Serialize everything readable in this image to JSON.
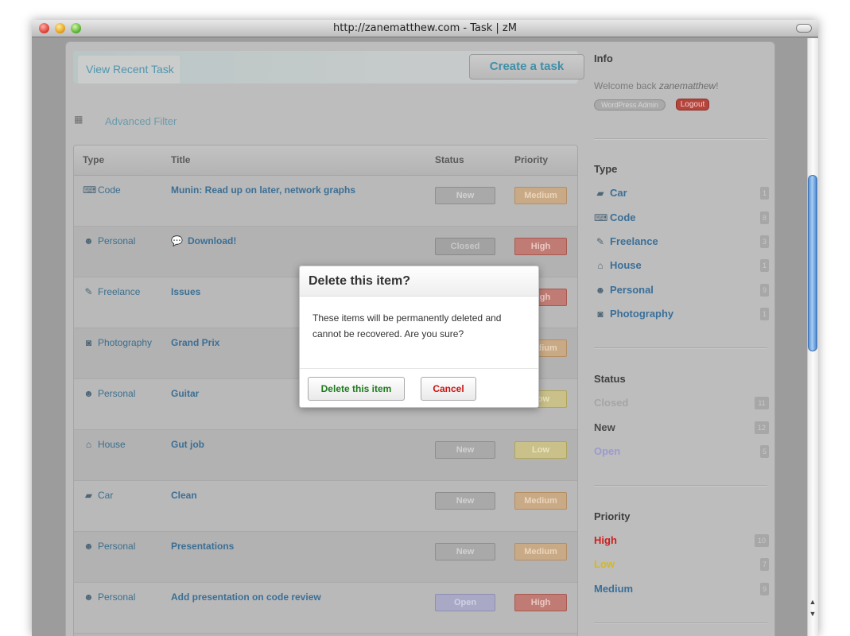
{
  "window": {
    "title": "http://zanematthew.com - Task | zM"
  },
  "header": {
    "tab_recent": "View Recent Task",
    "create_button": "Create a task",
    "filter_link": "Advanced Filter"
  },
  "table": {
    "columns": [
      "Type",
      "Title",
      "Status",
      "Priority"
    ],
    "rows": [
      {
        "type": "Code",
        "type_icon": "code-icon",
        "title": "Munin: Read up on later, network graphs",
        "status": "New",
        "priority": "Medium"
      },
      {
        "type": "Personal",
        "type_icon": "person-icon",
        "title": "Download!",
        "status": "Closed",
        "priority": "High"
      },
      {
        "type": "Freelance",
        "type_icon": "money-icon",
        "title": "Issues",
        "status": "",
        "priority": "High"
      },
      {
        "type": "Photography",
        "type_icon": "camera-icon",
        "title": "Grand Prix",
        "status": "",
        "priority": "Medium"
      },
      {
        "type": "Personal",
        "type_icon": "person-icon",
        "title": "Guitar",
        "status": "",
        "priority": "Low"
      },
      {
        "type": "House",
        "type_icon": "house-icon",
        "title": "Gut job",
        "status": "New",
        "priority": "Low"
      },
      {
        "type": "Car",
        "type_icon": "car-icon",
        "title": "Clean",
        "status": "New",
        "priority": "Medium"
      },
      {
        "type": "Personal",
        "type_icon": "person-icon",
        "title": "Presentations",
        "status": "New",
        "priority": "Medium"
      },
      {
        "type": "Personal",
        "type_icon": "person-icon",
        "title": "Add presentation on code review",
        "status": "Open",
        "priority": "High"
      }
    ]
  },
  "sidebar": {
    "info_heading": "Info",
    "welcome_prefix": "Welcome back ",
    "username": "zanematthew",
    "welcome_suffix": "!",
    "wp_admin": "WordPress Admin",
    "logout": "Logout",
    "type_heading": "Type",
    "types": [
      {
        "label": "Car",
        "icon": "car-icon",
        "count": "1"
      },
      {
        "label": "Code",
        "icon": "code-icon",
        "count": "8"
      },
      {
        "label": "Freelance",
        "icon": "money-icon",
        "count": "3"
      },
      {
        "label": "House",
        "icon": "house-icon",
        "count": "1"
      },
      {
        "label": "Personal",
        "icon": "person-icon",
        "count": "9"
      },
      {
        "label": "Photography",
        "icon": "camera-icon",
        "count": "1"
      }
    ],
    "status_heading": "Status",
    "statuses": [
      {
        "label": "Closed",
        "count": "11",
        "color": "#a5a5a5"
      },
      {
        "label": "New",
        "count": "12",
        "color": "#4a4a4a"
      },
      {
        "label": "Open",
        "count": "5",
        "color": "#9a9ad0"
      }
    ],
    "priority_heading": "Priority",
    "priorities": [
      {
        "label": "High",
        "count": "10",
        "color": "#cc1f1f"
      },
      {
        "label": "Low",
        "count": "7",
        "color": "#d6b81e"
      },
      {
        "label": "Medium",
        "count": "9",
        "color": "#3a6f99"
      }
    ]
  },
  "modal": {
    "title": "Delete this item?",
    "body": "These items will be permanently deleted and cannot be recovered. Are you sure?",
    "confirm": "Delete this item",
    "cancel": "Cancel"
  }
}
